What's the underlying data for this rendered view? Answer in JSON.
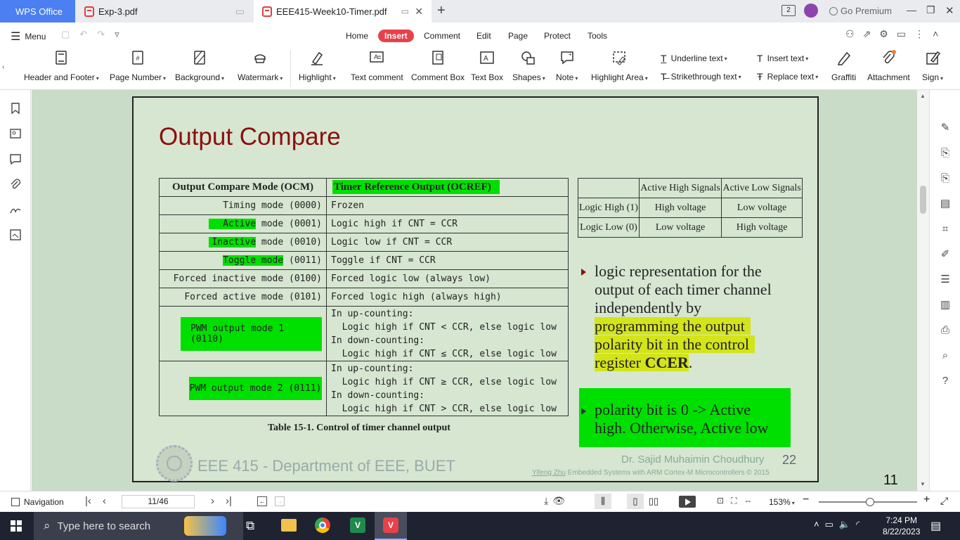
{
  "tabs": {
    "app": "WPS Office",
    "tab1": "Exp-3.pdf",
    "tab2": "EEE415-Week10-Timer.pdf",
    "notif": "2",
    "premium": "Go Premium"
  },
  "menu": {
    "label": "Menu",
    "items": [
      "Home",
      "Insert",
      "Comment",
      "Edit",
      "Page",
      "Protect",
      "Tools"
    ]
  },
  "ribbon": {
    "header_footer": "Header and Footer",
    "page_number": "Page Number",
    "background": "Background",
    "watermark": "Watermark",
    "highlight": "Highlight",
    "text_comment": "Text comment",
    "comment_box": "Comment Box",
    "text_box": "Text Box",
    "shapes": "Shapes",
    "note": "Note",
    "highlight_area": "Highlight Area",
    "underline_text": "Underline text",
    "strikethrough_text": "Strikethrough text",
    "insert_text": "Insert text",
    "replace_text": "Replace text",
    "graffiti": "Graffiti",
    "attachment": "Attachment",
    "sign": "Sign"
  },
  "slide": {
    "title": "Output Compare",
    "table_header": [
      "Output Compare Mode (OCM)",
      "Timer Reference Output (OCREF)"
    ],
    "rows": [
      {
        "mode_hl": "",
        "mode": "Timing mode (0000)",
        "out": "Frozen"
      },
      {
        "mode_hl": "Active",
        "mode": " mode (0001)",
        "out": "Logic high if CNT = CCR"
      },
      {
        "mode_hl": "Inactive",
        "mode": " mode (0010)",
        "out": "Logic low if CNT = CCR"
      },
      {
        "mode_hl": "Toggle mode",
        "mode": " (0011)",
        "out": "Toggle if CNT = CCR"
      },
      {
        "mode_hl": "",
        "mode": "Forced inactive mode (0100)",
        "out": "Forced logic low (always low)"
      },
      {
        "mode_hl": "",
        "mode": "Forced active mode (0101)",
        "out": "Forced logic high (always high)"
      }
    ],
    "pwm1": {
      "mode": "PWM output mode 1 (0110)",
      "l1": "In up-counting:",
      "l2": "  Logic high if CNT < CCR, else logic low",
      "l3": "In down-counting:",
      "l4": "  Logic high if CNT ≤ CCR, else logic low"
    },
    "pwm2": {
      "mode": "PWM output mode 2 (0111)",
      "l1": "In up-counting:",
      "l2": "  Logic high if CNT ≥ CCR, else logic low",
      "l3": "In down-counting:",
      "l4": "  Logic high if CNT > CCR, else logic low"
    },
    "caption": "Table 15-1. Control of timer channel output",
    "sig": {
      "h1": "Active High Signals",
      "h2": "Active Low Signals",
      "r1": "Logic High (1)",
      "r1a": "High voltage",
      "r1b": "Low voltage",
      "r2": "Logic Low (0)",
      "r2a": "Low voltage",
      "r2b": "High voltage"
    },
    "bullet1": {
      "a": "logic representation for the",
      "b": "output of each timer channel",
      "c": "independently by",
      "d": "programming the output",
      "e": "polarity bit in the control",
      "f": "register ",
      "g": "CCER",
      "h": "."
    },
    "bullet2": {
      "a": "polarity bit is 0 -> Active",
      "b": "high. Otherwise, Active low"
    },
    "footer_dept": "EEE 415 - Department of EEE, BUET",
    "footer_author": "Dr. Sajid Muhaimin Choudhury",
    "footer_num": "22",
    "footer_ref_a": "Yifeng Zhu",
    "footer_ref_b": " Embedded Systems with ARM Cortex-M Microcontrollers © 2015",
    "page_no": "11"
  },
  "status": {
    "navigation": "Navigation",
    "page": "11/46",
    "zoom": "153%"
  },
  "taskbar": {
    "search": "Type here to search",
    "time": "7:24 PM",
    "date": "8/22/2023"
  }
}
